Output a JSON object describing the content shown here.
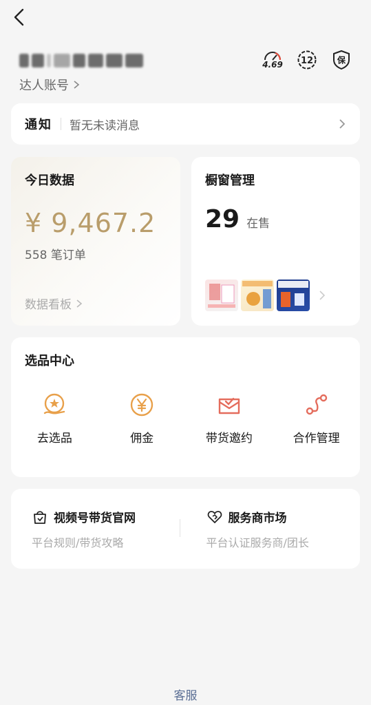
{
  "header": {
    "account_label": "达人账号",
    "score_value": "4.69",
    "badge_number": "12",
    "guarantee_label": "保"
  },
  "notice": {
    "title": "通知",
    "message": "暂无未读消息"
  },
  "today": {
    "title": "今日数据",
    "amount": "¥ 9,467.2",
    "orders": "558 笔订单",
    "board_label": "数据看板"
  },
  "window": {
    "title": "橱窗管理",
    "count": "29",
    "status": "在售"
  },
  "selection": {
    "title": "选品中心",
    "items": [
      {
        "label": "去选品",
        "icon": "select-product-icon"
      },
      {
        "label": "佣金",
        "icon": "yen-icon"
      },
      {
        "label": "带货邀约",
        "icon": "invite-mail-icon"
      },
      {
        "label": "合作管理",
        "icon": "cooperation-icon"
      }
    ]
  },
  "links": {
    "official": {
      "title": "视频号带货官网",
      "sub": "平台规则/带货攻略"
    },
    "market": {
      "title": "服务商市场",
      "sub": "平台认证服务商/团长"
    }
  },
  "footer": {
    "service": "客服"
  },
  "colors": {
    "accent": "#e8a04a",
    "gold": "#b99d6b",
    "link": "#5a6e94"
  }
}
